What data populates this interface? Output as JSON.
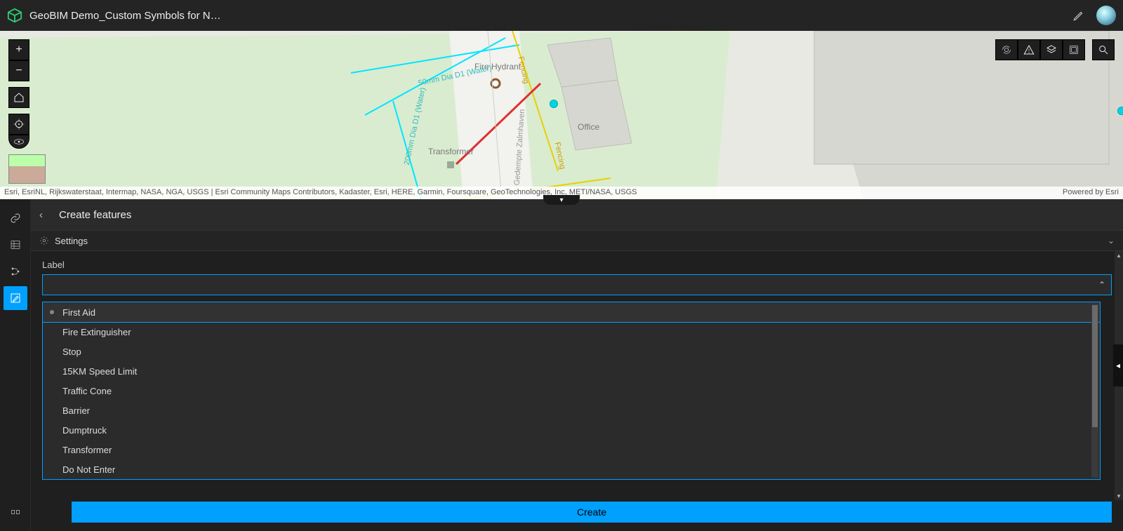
{
  "header": {
    "title": "GeoBIM Demo_Custom Symbols for N…"
  },
  "map": {
    "labels": {
      "fireHydrant": "Fire Hydrant",
      "transformer": "Transformer",
      "office": "Office",
      "pipe50": "50mm Dia D1 (Water)",
      "pipe200": "200mm Dia D1 (Water)",
      "fencing": "Fencing",
      "street": "Gedempte Zalmhaven"
    },
    "attribution": "Esri, EsriNL, Rijkswaterstaat, Intermap, NASA, NGA, USGS | Esri Community Maps Contributors, Kadaster, Esri, HERE, Garmin, Foursquare, GeoTechnologies, Inc, METI/NASA, USGS",
    "poweredBy": "Powered by Esri"
  },
  "leftTools": {
    "zoomIn": "+",
    "zoomOut": "−",
    "home": "⌂",
    "locate": "⊕",
    "view": "👁"
  },
  "rightTools": {
    "around": "⟳",
    "warning": "△",
    "layers": "◈",
    "basemap": "▣",
    "search": "🔍"
  },
  "panel": {
    "title": "Create features",
    "settings": "Settings",
    "fieldLabel": "Label",
    "options": [
      "First Aid",
      "Fire Extinguisher",
      "Stop",
      "15KM Speed Limit",
      "Traffic Cone",
      "Barrier",
      "Dumptruck",
      "Transformer",
      "Do Not Enter"
    ],
    "selectedIndex": 0,
    "createButton": "Create"
  },
  "vtabs": {
    "link": "link-icon",
    "table": "table-icon",
    "branch": "branch-icon",
    "edit": "edit-icon",
    "expand": "expand-icon"
  }
}
